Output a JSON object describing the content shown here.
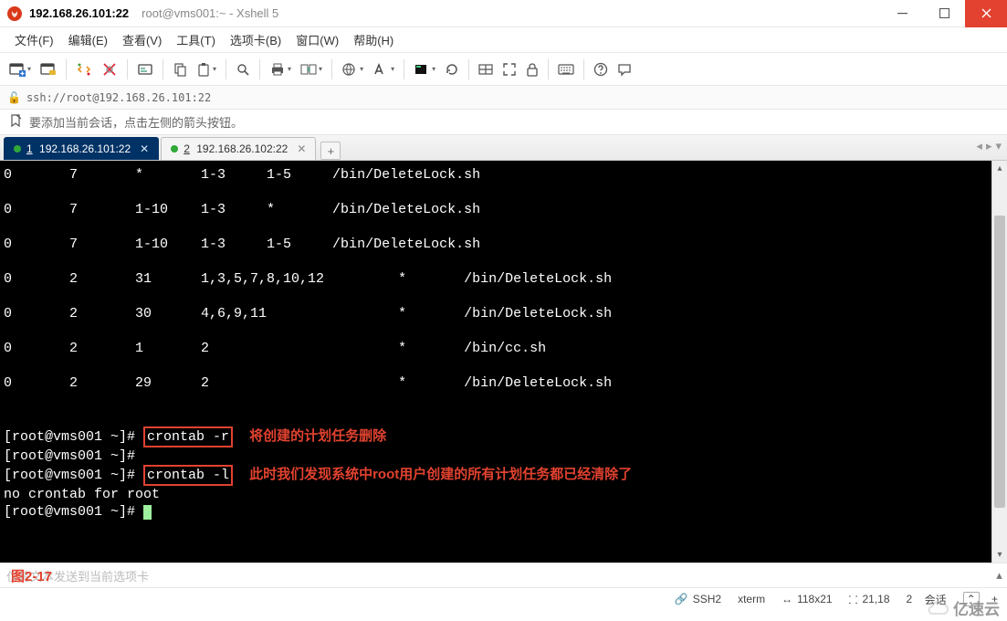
{
  "title": {
    "main": "192.168.26.101:22",
    "sub": "root@vms001:~ - Xshell 5"
  },
  "menu": {
    "file": "文件(F)",
    "edit": "编辑(E)",
    "view": "查看(V)",
    "tools": "工具(T)",
    "tabs": "选项卡(B)",
    "window": "窗口(W)",
    "help": "帮助(H)"
  },
  "address": "ssh://root@192.168.26.101:22",
  "hint": "要添加当前会话，点击左侧的箭头按钮。",
  "tabs": [
    {
      "index": "1",
      "label": "192.168.26.101:22",
      "active": true
    },
    {
      "index": "2",
      "label": "192.168.26.102:22",
      "active": false
    }
  ],
  "terminal": {
    "rows": [
      "0       7       *       1-3     1-5     /bin/DeleteLock.sh",
      "",
      "0       7       1-10    1-3     *       /bin/DeleteLock.sh",
      "",
      "0       7       1-10    1-3     1-5     /bin/DeleteLock.sh",
      "",
      "0       2       31      1,3,5,7,8,10,12         *       /bin/DeleteLock.sh",
      "",
      "0       2       30      4,6,9,11                *       /bin/DeleteLock.sh",
      "",
      "0       2       1       2                       *       /bin/cc.sh",
      "",
      "0       2       29      2                       *       /bin/DeleteLock.sh"
    ],
    "prompt": "[root@vms001 ~]#",
    "cmd1": "crontab -r",
    "comment1": "将创建的计划任务删除",
    "cmd2": "crontab -l",
    "comment2": "此时我们发现系统中root用户创建的所有计划任务都已经清除了",
    "out2": "no crontab for root"
  },
  "figure_label": "图2-17",
  "sendhint": "仅将文本发送到当前选项卡",
  "status": {
    "proto": "SSH2",
    "term": "xterm",
    "size": "118x21",
    "pos": "21,18",
    "sessions": "2",
    "sessions_label": "会话",
    "expand": "⌃"
  },
  "watermark_text": "亿速云"
}
